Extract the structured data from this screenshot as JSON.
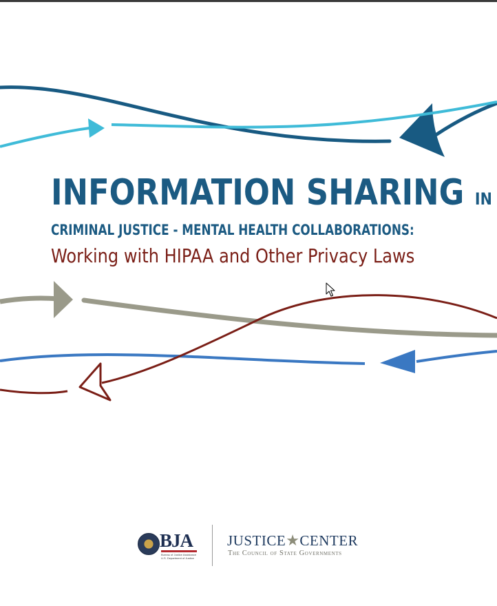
{
  "title": {
    "main": "INFORMATION SHARING",
    "main_suffix": "IN",
    "subtitle": "CRIMINAL JUSTICE - MENTAL HEALTH COLLABORATIONS:",
    "tagline": "Working with HIPAA and Other Privacy Laws"
  },
  "logos": {
    "bja": {
      "name": "BJA",
      "caption": "Bureau of Justice Assistance U.S. Department of Justice"
    },
    "justice_center": {
      "name_left": "JUSTICE",
      "name_right": "CENTER",
      "subtitle": "The Council of State Governments"
    }
  },
  "colors": {
    "title_blue": "#1b5a82",
    "tagline_red": "#7a1e16",
    "arrow_dark_blue": "#185a82",
    "arrow_light_blue": "#3fbbd8",
    "arrow_gray": "#9a9a8a",
    "arrow_mid_blue": "#3a78c2",
    "arrow_dark_red": "#7a1e16"
  },
  "icons": {
    "cursor": "mouse-pointer-icon",
    "seal": "doj-seal-icon",
    "star": "star-icon"
  }
}
